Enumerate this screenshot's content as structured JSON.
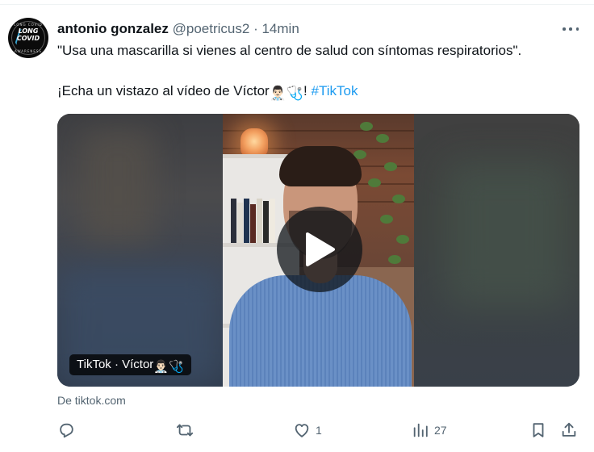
{
  "tweet": {
    "author_name": "antonio gonzalez",
    "author_handle": "@poetricus2",
    "separator": "·",
    "time": "14min",
    "text_line1": "\"Usa una mascarilla si vienes al centro de salud con síntomas respiratorios\".",
    "text_line2_prefix": "¡Echa un vistazo al vídeo de Víctor",
    "text_line2_emoji": "👨🏻‍⚕️🩺",
    "text_line2_bang": "!",
    "hashtag": "#TikTok"
  },
  "avatar": {
    "logo_top": "LONG COVID",
    "logo_main_1": "LONG",
    "logo_main_2": "COVID",
    "logo_bottom": "AWARENESS"
  },
  "media": {
    "overlay_label": "TikTok · Víctor",
    "overlay_emoji": "👨🏻‍⚕️🩺",
    "link_domain": "De tiktok.com"
  },
  "actions": {
    "reply_count": "",
    "retweet_count": "",
    "like_count": "1",
    "views_count": "27"
  },
  "colors": {
    "text_primary": "#0f1419",
    "text_secondary": "#536471",
    "link": "#1d9bf0"
  },
  "icons": [
    "more-icon",
    "play-icon",
    "reply-icon",
    "retweet-icon",
    "like-icon",
    "views-icon",
    "bookmark-icon",
    "share-icon"
  ]
}
